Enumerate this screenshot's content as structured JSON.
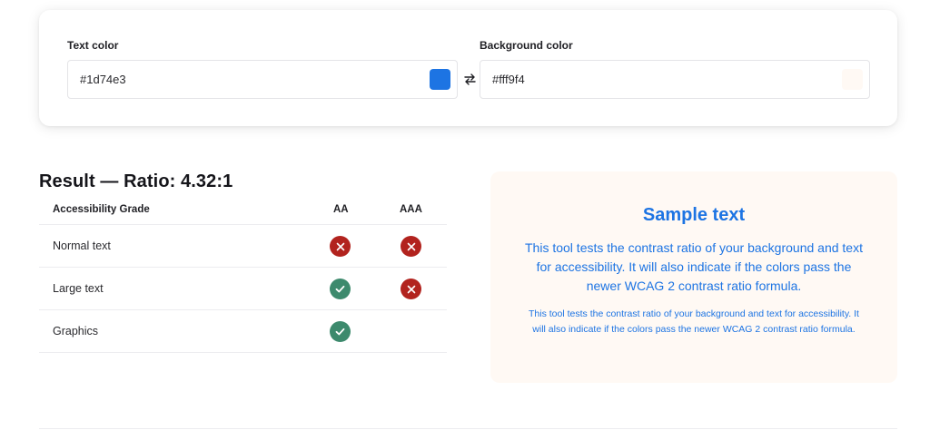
{
  "text_color": {
    "label": "Text color",
    "value": "#1d74e3",
    "swatch": "#1d74e3"
  },
  "background_color": {
    "label": "Background color",
    "value": "#fff9f4",
    "swatch": "#fff9f4"
  },
  "swap_icon": "swap-arrows-icon",
  "result": {
    "title": "Result — Ratio: 4.32:1",
    "headers": {
      "grade": "Accessibility Grade",
      "aa": "AA",
      "aaa": "AAA"
    },
    "rows": [
      {
        "label": "Normal text",
        "aa": "fail",
        "aaa": "fail"
      },
      {
        "label": "Large text",
        "aa": "pass",
        "aaa": "fail"
      },
      {
        "label": "Graphics",
        "aa": "pass",
        "aaa": ""
      }
    ],
    "colors": {
      "pass": "#3d8a6d",
      "fail": "#b2231e"
    }
  },
  "sample": {
    "title": "Sample text",
    "large_text": "This tool tests the contrast ratio of your background and text for accessibility. It will also indicate if the colors pass the newer WCAG 2 contrast ratio formula.",
    "small_text": "This tool tests the contrast ratio of your background and text for accessibility. It will also indicate if the colors pass the newer WCAG 2 contrast ratio formula."
  }
}
